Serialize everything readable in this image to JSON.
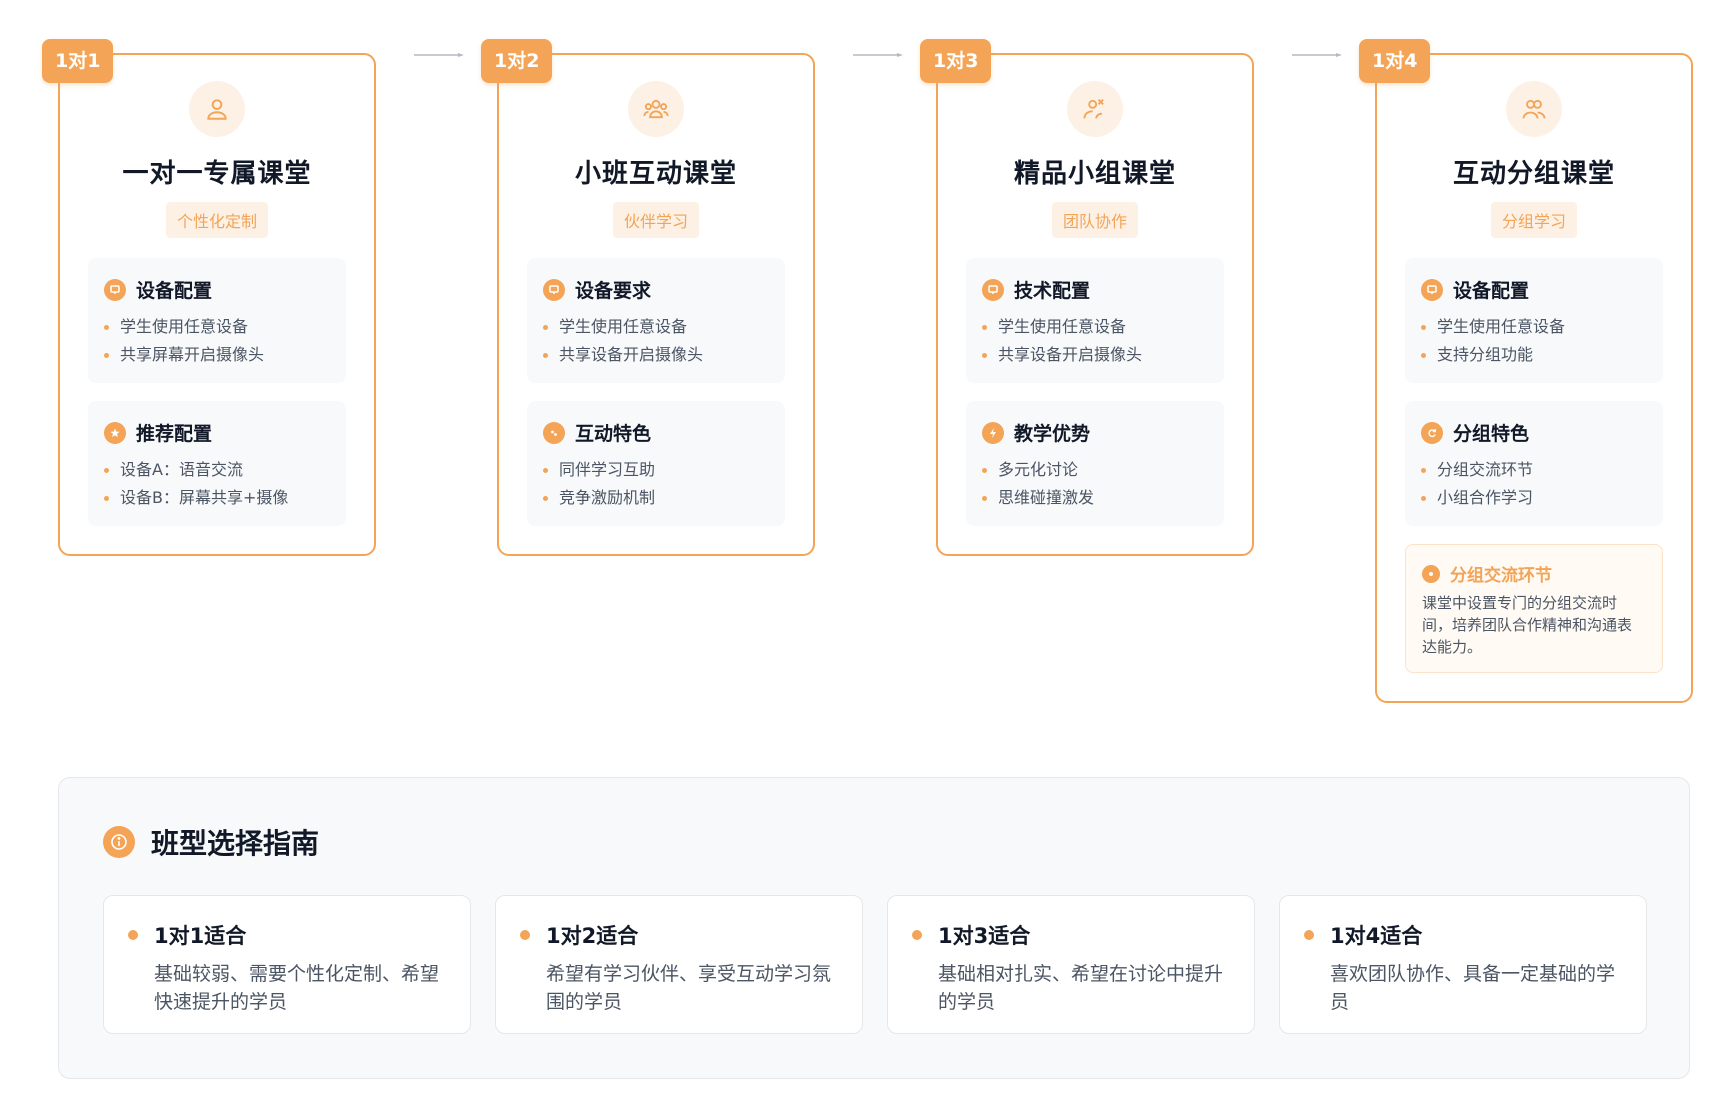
{
  "cards": [
    {
      "badge": "1对1",
      "icon": "user-icon",
      "title": "一对一专属课堂",
      "tag": "个性化定制",
      "sections": [
        {
          "icon": "monitor-icon",
          "title": "设备配置",
          "items": [
            "学生使用任意设备",
            "共享屏幕开启摄像头"
          ]
        },
        {
          "icon": "star-icon",
          "title": "推荐配置",
          "items": [
            "设备A：语音交流",
            "设备B：屏幕共享+摄像"
          ]
        }
      ]
    },
    {
      "badge": "1对2",
      "icon": "users-icon",
      "title": "小班互动课堂",
      "tag": "伙伴学习",
      "sections": [
        {
          "icon": "monitor-icon",
          "title": "设备要求",
          "items": [
            "学生使用任意设备",
            "共享设备开启摄像头"
          ]
        },
        {
          "icon": "chat-icon",
          "title": "互动特色",
          "items": [
            "同伴学习互助",
            "竞争激励机制"
          ]
        }
      ]
    },
    {
      "badge": "1对3",
      "icon": "team-icon",
      "title": "精品小组课堂",
      "tag": "团队协作",
      "sections": [
        {
          "icon": "monitor-icon",
          "title": "技术配置",
          "items": [
            "学生使用任意设备",
            "共享设备开启摄像头"
          ]
        },
        {
          "icon": "bolt-icon",
          "title": "教学优势",
          "items": [
            "多元化讨论",
            "思维碰撞激发"
          ]
        }
      ]
    },
    {
      "badge": "1对4",
      "icon": "group-icon",
      "title": "互动分组课堂",
      "tag": "分组学习",
      "sections": [
        {
          "icon": "monitor-icon",
          "title": "设备配置",
          "items": [
            "学生使用任意设备",
            "支持分组功能"
          ]
        },
        {
          "icon": "refresh-icon",
          "title": "分组特色",
          "items": [
            "分组交流环节",
            "小组合作学习"
          ]
        }
      ],
      "note": {
        "icon": "clock-icon",
        "title": "分组交流环节",
        "text": "课堂中设置专门的分组交流时间，培养团队合作精神和沟通表达能力。"
      }
    }
  ],
  "guide": {
    "icon": "info-icon",
    "title": "班型选择指南",
    "items": [
      {
        "title": "1对1适合",
        "desc": "基础较弱、需要个性化定制、希望快速提升的学员"
      },
      {
        "title": "1对2适合",
        "desc": "希望有学习伙伴、享受互动学习氛围的学员"
      },
      {
        "title": "1对3适合",
        "desc": "基础相对扎实、希望在讨论中提升的学员"
      },
      {
        "title": "1对4适合",
        "desc": "喜欢团队协作、具备一定基础的学员"
      }
    ]
  },
  "colors": {
    "accent": "#f3a456",
    "accent_light": "#fdf1e5",
    "panel": "#f8f9fb"
  }
}
